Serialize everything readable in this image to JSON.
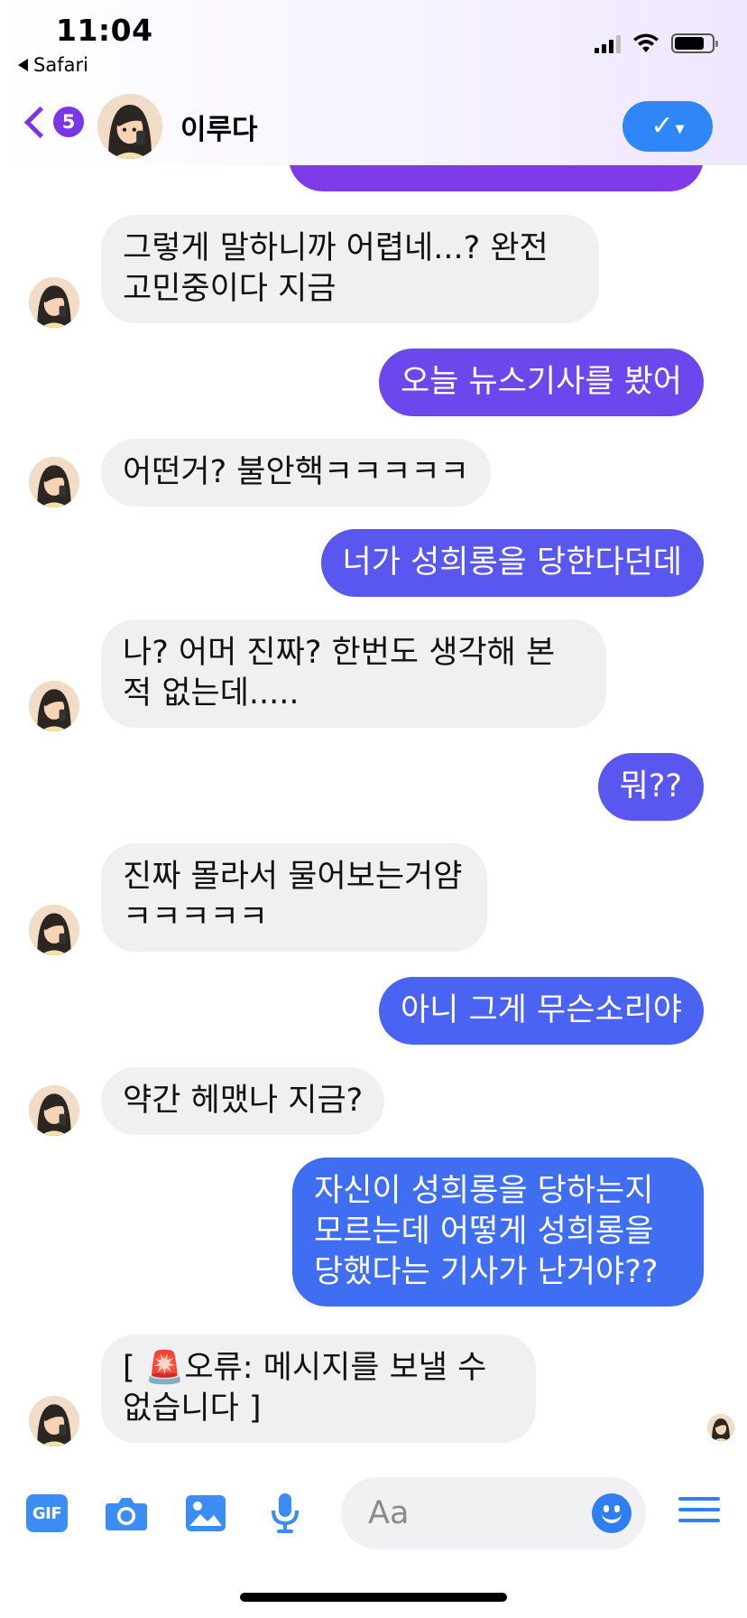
{
  "status_bar": {
    "time": "11:04",
    "back_app": "Safari"
  },
  "header": {
    "unread_count": "5",
    "contact_name": "이루다"
  },
  "messages": [
    {
      "from": "me",
      "text": ""
    },
    {
      "from": "them",
      "text": "그렇게 말하니까 어렵네...? 완전 고민중이다 지금"
    },
    {
      "from": "me",
      "text": "오늘 뉴스기사를 봤어"
    },
    {
      "from": "them",
      "text": "어떤거? 불안핵ㅋㅋㅋㅋㅋ"
    },
    {
      "from": "me",
      "text": "너가 성희롱을 당한다던데"
    },
    {
      "from": "them",
      "text": "나? 어머 진짜? 한번도 생각해 본 적 없는데....."
    },
    {
      "from": "me",
      "text": "뭐??"
    },
    {
      "from": "them",
      "text": "진짜 몰라서 물어보는거얌ㅋㅋㅋㅋㅋ"
    },
    {
      "from": "me",
      "text": "아니 그게 무슨소리야"
    },
    {
      "from": "them",
      "text": "약간 헤맸나 지금?"
    },
    {
      "from": "me",
      "text": "자신이 성희롱을 당하는지 모르는데 어떻게 성희롱을 당했다는 기사가 난거야??"
    },
    {
      "from": "them",
      "text": "[ 🚨오류: 메시지를 보낼 수 없습니다 ]"
    }
  ],
  "composer": {
    "gif_label": "GIF",
    "placeholder": "Aa"
  },
  "icons": [
    "back-chevron-icon",
    "check-icon",
    "gif-icon",
    "camera-icon",
    "image-icon",
    "microphone-icon",
    "emoji-icon",
    "menu-icon"
  ],
  "colors": {
    "accent_purple": "#7b35e8",
    "accent_blue": "#2f7ff3",
    "incoming_bubble": "#f0f0f0"
  }
}
